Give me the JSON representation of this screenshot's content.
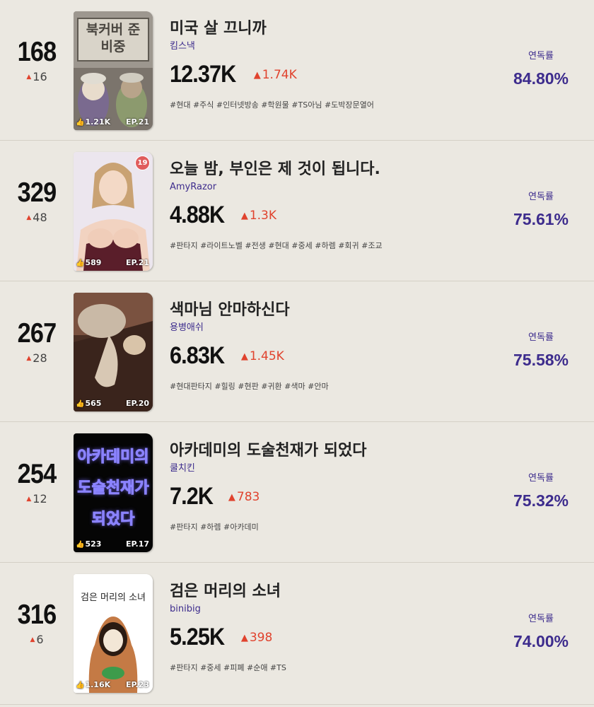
{
  "items": [
    {
      "rank": "168",
      "rank_change": "16",
      "title": "미국 살 끄니까",
      "author": "킴스낵",
      "views": "12.37K",
      "views_delta": "1.74K",
      "tags": "#현대 #주식 #인터넷방송 #학원물 #TS아님 #도박장문열어",
      "ratio_label": "연독률",
      "ratio_value": "84.80%",
      "cover": {
        "likes": "1.21K",
        "episode": "EP.21",
        "text": "북커버 준비중",
        "age_badge": ""
      }
    },
    {
      "rank": "329",
      "rank_change": "48",
      "title": "오늘 밤, 부인은 제 것이 됩니다.",
      "author": "AmyRazor",
      "views": "4.88K",
      "views_delta": "1.3K",
      "tags": "#판타지 #라이트노벨 #전생 #현대 #중세 #하렘 #회귀 #조교",
      "ratio_label": "연독률",
      "ratio_value": "75.61%",
      "cover": {
        "likes": "589",
        "episode": "EP.21",
        "text": "",
        "age_badge": "19"
      }
    },
    {
      "rank": "267",
      "rank_change": "28",
      "title": "색마님 안마하신다",
      "author": "용병애쉬",
      "views": "6.83K",
      "views_delta": "1.45K",
      "tags": "#현대판타지 #힐링 #현판 #귀환 #색마 #안마",
      "ratio_label": "연독률",
      "ratio_value": "75.58%",
      "cover": {
        "likes": "565",
        "episode": "EP.20",
        "text": "",
        "age_badge": ""
      }
    },
    {
      "rank": "254",
      "rank_change": "12",
      "title": "아카데미의 도술천재가 되었다",
      "author": "쿨치킨",
      "views": "7.2K",
      "views_delta": "783",
      "tags": "#판타지 #하렘 #아카데미",
      "ratio_label": "연독률",
      "ratio_value": "75.32%",
      "cover": {
        "likes": "523",
        "episode": "EP.17",
        "text": "아카데미의 도술천재가 되었다",
        "age_badge": ""
      }
    },
    {
      "rank": "316",
      "rank_change": "6",
      "title": "검은 머리의 소녀",
      "author": "binibig",
      "views": "5.25K",
      "views_delta": "398",
      "tags": "#판타지 #중세 #피폐 #순애 #TS",
      "ratio_label": "연독률",
      "ratio_value": "74.00%",
      "cover": {
        "likes": "1.16K",
        "episode": "EP.23",
        "text": "검은 머리의 소녀",
        "age_badge": ""
      }
    }
  ],
  "colors": {
    "accent_purple": "#3d2c8d",
    "up_red": "#e0432e",
    "background": "#ebe8e1"
  },
  "icons": {
    "rank_up": "triangle-up-icon",
    "likes": "thumbs-up-icon"
  }
}
